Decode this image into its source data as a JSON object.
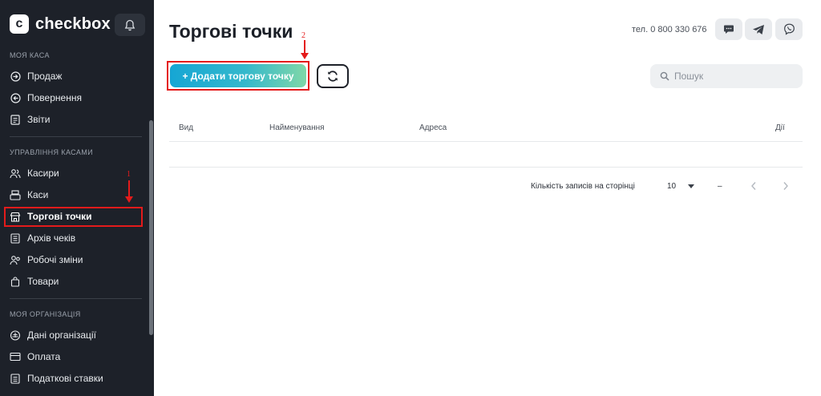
{
  "brand": {
    "logo_letter": "c",
    "name": "checkbox"
  },
  "sidebar": {
    "sections": [
      {
        "title": "МОЯ КАСА"
      },
      {
        "title": "УПРАВЛІННЯ КАСАМИ"
      },
      {
        "title": "МОЯ ОРГАНІЗАЦІЯ"
      }
    ],
    "items": [
      {
        "label": "Продаж",
        "icon": "arrow-in-circle-icon"
      },
      {
        "label": "Повернення",
        "icon": "arrow-back-circle-icon"
      },
      {
        "label": "Звіти",
        "icon": "report-icon"
      },
      {
        "label": "Касири",
        "icon": "users-icon"
      },
      {
        "label": "Каси",
        "icon": "cash-register-icon"
      },
      {
        "label": "Торгові точки",
        "icon": "store-icon",
        "active": true
      },
      {
        "label": "Архів чеків",
        "icon": "receipt-archive-icon"
      },
      {
        "label": "Робочі зміни",
        "icon": "shifts-icon"
      },
      {
        "label": "Товари",
        "icon": "shopping-bag-icon"
      },
      {
        "label": "Дані організації",
        "icon": "organization-icon"
      },
      {
        "label": "Оплата",
        "icon": "payment-card-icon"
      },
      {
        "label": "Податкові ставки",
        "icon": "tax-icon"
      }
    ]
  },
  "annotations": {
    "step1": "1",
    "step2": "2",
    "color": "#e41b1b"
  },
  "header": {
    "title": "Торгові точки",
    "phone": "тел. 0 800 330 676"
  },
  "toolbar": {
    "add_label": "+ Додати торгову точку",
    "search_placeholder": "Пошук"
  },
  "table": {
    "columns": [
      "Вид",
      "Найменування",
      "Адреса",
      "Дії"
    ]
  },
  "pagination": {
    "rows_label": "Кількість записів на сторінці",
    "rows_value": "10",
    "range": "–"
  },
  "colors": {
    "sidebar_bg": "#1d2129",
    "accent_start": "#16a6d4",
    "accent_end": "#7fd7a8"
  }
}
